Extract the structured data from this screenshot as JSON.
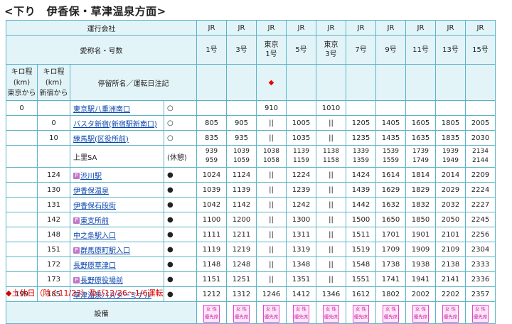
{
  "title": "<下り　伊香保・草津温泉方面>",
  "header": {
    "operator_label": "運行会社",
    "name_label": "愛称名・号数",
    "stop_label": "停留所名／運転日注記",
    "km_tokyo": [
      "キロ程",
      "(km)",
      "東京から"
    ],
    "km_shinjuku": [
      "キロ程",
      "(km)",
      "新宿から"
    ]
  },
  "services": [
    {
      "op": "JR",
      "name": [
        "1号"
      ],
      "mark": ""
    },
    {
      "op": "JR",
      "name": [
        "3号"
      ],
      "mark": ""
    },
    {
      "op": "JR",
      "name": [
        "東京",
        "1号"
      ],
      "mark": "◆"
    },
    {
      "op": "JR",
      "name": [
        "5号"
      ],
      "mark": ""
    },
    {
      "op": "JR",
      "name": [
        "東京",
        "3号"
      ],
      "mark": ""
    },
    {
      "op": "JR",
      "name": [
        "7号"
      ],
      "mark": ""
    },
    {
      "op": "JR",
      "name": [
        "9号"
      ],
      "mark": ""
    },
    {
      "op": "JR",
      "name": [
        "11号"
      ],
      "mark": ""
    },
    {
      "op": "JR",
      "name": [
        "13号"
      ],
      "mark": ""
    },
    {
      "op": "JR",
      "name": [
        "15号"
      ],
      "mark": ""
    }
  ],
  "stops": [
    {
      "km1": "0",
      "km2": "",
      "name": "東京駅八重洲南口",
      "p": false,
      "link": true,
      "m": "○",
      "times": [
        "",
        "",
        "910",
        "",
        "1010",
        "",
        "",
        "",
        "",
        ""
      ]
    },
    {
      "km1": "",
      "km2": "0",
      "name": "バスタ新宿(新宿駅新南口)",
      "p": false,
      "link": true,
      "m": "○",
      "times": [
        "805",
        "905",
        "||",
        "1005",
        "||",
        "1205",
        "1405",
        "1605",
        "1805",
        "2005"
      ]
    },
    {
      "km1": "",
      "km2": "10",
      "name": "練馬駅(区役所前)",
      "p": false,
      "link": true,
      "m": "○",
      "times": [
        "835",
        "935",
        "||",
        "1035",
        "||",
        "1235",
        "1435",
        "1635",
        "1835",
        "2030"
      ]
    },
    {
      "km1": "",
      "km2": "",
      "name": "上里SA",
      "p": false,
      "link": false,
      "m": "(休憩)",
      "dbl": true,
      "times": [
        [
          "939",
          "959"
        ],
        [
          "1039",
          "1059"
        ],
        [
          "1038",
          "1058"
        ],
        [
          "1139",
          "1159"
        ],
        [
          "1138",
          "1158"
        ],
        [
          "1339",
          "1359"
        ],
        [
          "1539",
          "1559"
        ],
        [
          "1739",
          "1749"
        ],
        [
          "1939",
          "1949"
        ],
        [
          "2134",
          "2144"
        ]
      ]
    },
    {
      "km1": "",
      "km2": "124",
      "name": "渋川駅",
      "p": true,
      "link": true,
      "m": "●",
      "times": [
        "1024",
        "1124",
        "||",
        "1224",
        "||",
        "1424",
        "1614",
        "1814",
        "2014",
        "2209"
      ]
    },
    {
      "km1": "",
      "km2": "130",
      "name": "伊香保温泉",
      "p": false,
      "link": true,
      "m": "●",
      "times": [
        "1039",
        "1139",
        "||",
        "1239",
        "||",
        "1439",
        "1629",
        "1829",
        "2029",
        "2224"
      ]
    },
    {
      "km1": "",
      "km2": "131",
      "name": "伊香保石段街",
      "p": false,
      "link": true,
      "m": "●",
      "times": [
        "1042",
        "1142",
        "||",
        "1242",
        "||",
        "1442",
        "1632",
        "1832",
        "2032",
        "2227"
      ]
    },
    {
      "km1": "",
      "km2": "142",
      "name": "東支所前",
      "p": true,
      "link": true,
      "m": "●",
      "times": [
        "1100",
        "1200",
        "||",
        "1300",
        "||",
        "1500",
        "1650",
        "1850",
        "2050",
        "2245"
      ]
    },
    {
      "km1": "",
      "km2": "148",
      "name": "中之条駅入口",
      "p": false,
      "link": true,
      "m": "●",
      "times": [
        "1111",
        "1211",
        "||",
        "1311",
        "||",
        "1511",
        "1701",
        "1901",
        "2101",
        "2256"
      ]
    },
    {
      "km1": "",
      "km2": "151",
      "name": "群馬原町駅入口",
      "p": true,
      "link": true,
      "m": "●",
      "times": [
        "1119",
        "1219",
        "||",
        "1319",
        "||",
        "1519",
        "1709",
        "1909",
        "2109",
        "2304"
      ]
    },
    {
      "km1": "",
      "km2": "172",
      "name": "長野原草津口",
      "p": false,
      "link": true,
      "m": "●",
      "times": [
        "1148",
        "1248",
        "||",
        "1348",
        "||",
        "1548",
        "1738",
        "1938",
        "2138",
        "2333"
      ]
    },
    {
      "km1": "",
      "km2": "173",
      "name": "長野原役場前",
      "p": true,
      "link": true,
      "m": "●",
      "times": [
        "1151",
        "1251",
        "||",
        "1351",
        "||",
        "1551",
        "1741",
        "1941",
        "2141",
        "2336"
      ]
    },
    {
      "km1": "199",
      "km2": "185",
      "name": "草津温泉バスターミナル",
      "p": false,
      "link": true,
      "m": "●",
      "times": [
        "1212",
        "1312",
        "1246",
        "1412",
        "1346",
        "1612",
        "1802",
        "2002",
        "2202",
        "2357"
      ]
    }
  ],
  "facility": {
    "label": "設備",
    "badge": [
      "女 性",
      "優先席"
    ]
  },
  "footnote": "◆土休日（除く11/23）及び12/26～1/6運転",
  "colors": {
    "border": "#5ab4c8",
    "header_bg": "#e3f4f8",
    "badge": "#e048c8",
    "footnote": "#dd0000"
  }
}
